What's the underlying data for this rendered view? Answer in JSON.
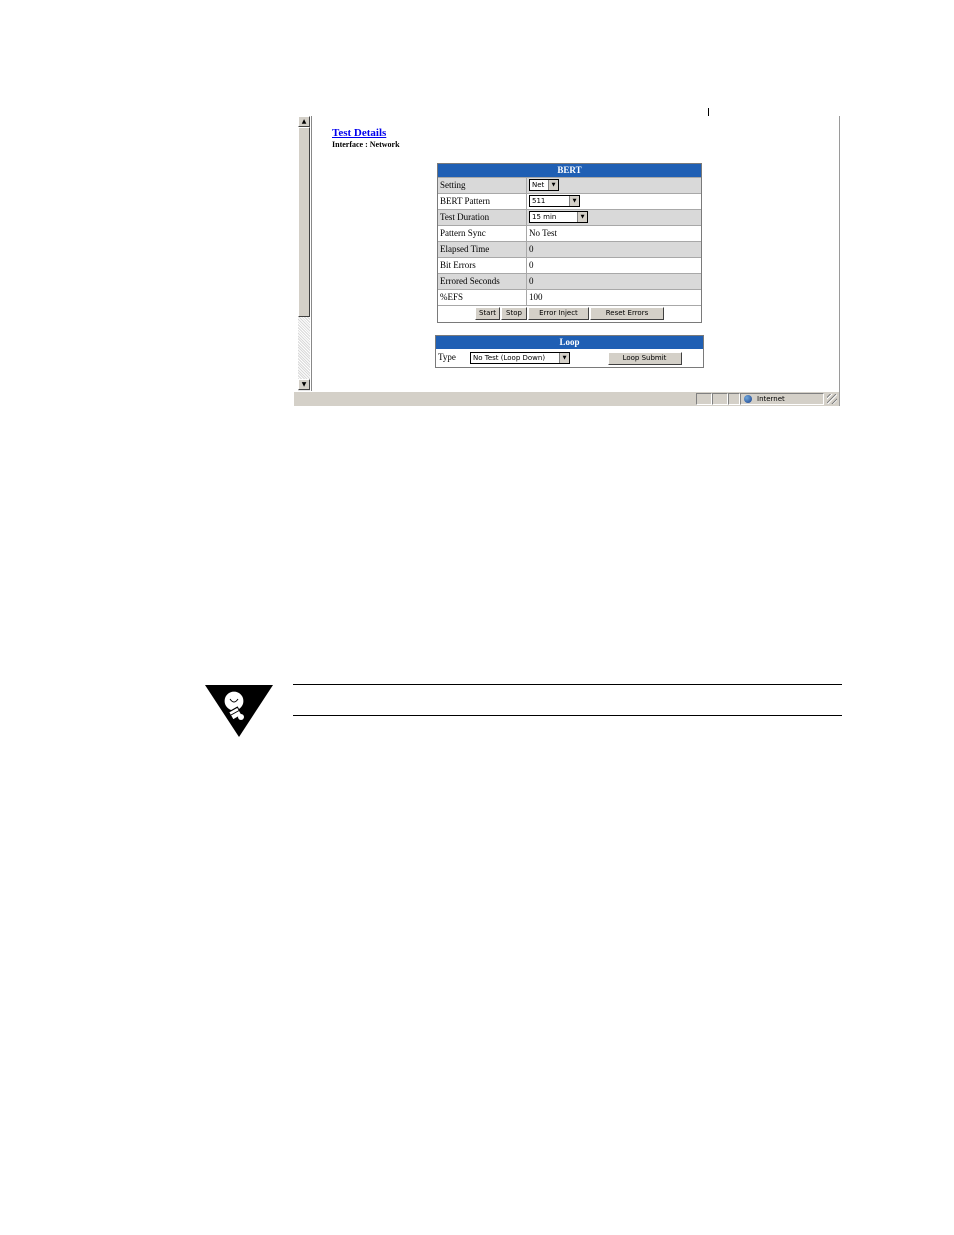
{
  "page": {
    "title": "Test Details",
    "subtitle": "Interface : Network"
  },
  "bert": {
    "header": "BERT",
    "rows": [
      {
        "label": "Setting",
        "value": "Net"
      },
      {
        "label": "BERT Pattern",
        "value": "511"
      },
      {
        "label": "Test Duration",
        "value": "15 min"
      },
      {
        "label": "Pattern Sync",
        "value": "No Test"
      },
      {
        "label": "Elapsed Time",
        "value": "0"
      },
      {
        "label": "Bit Errors",
        "value": "0"
      },
      {
        "label": "Errored Seconds",
        "value": "0"
      },
      {
        "label": "%EFS",
        "value": "100"
      }
    ],
    "buttons": {
      "start": "Start",
      "stop": "Stop",
      "error_inject": "Error Inject",
      "reset_errors": "Reset Errors"
    }
  },
  "loop": {
    "header": "Loop",
    "type_label": "Type",
    "type_value": "No Test (Loop Down)",
    "submit": "Loop Submit"
  },
  "statusbar": {
    "zone": "Internet",
    "zone_icon": "globe-icon"
  },
  "scrollbar": {
    "up_icon": "scroll-up-arrow-icon",
    "down_icon": "scroll-down-arrow-icon"
  },
  "note": {
    "icon": "lightbulb-note-icon"
  }
}
